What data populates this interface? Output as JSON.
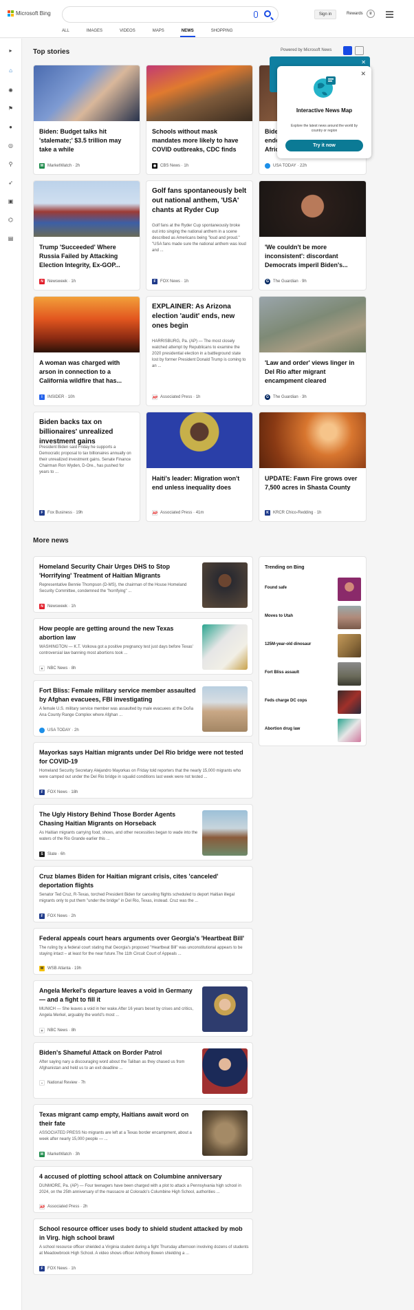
{
  "header": {
    "brand": "Microsoft Bing",
    "search_value": "",
    "signin": "Sign in",
    "rewards": "Rewards",
    "tabs": [
      "ALL",
      "IMAGES",
      "VIDEOS",
      "MAPS",
      "NEWS",
      "SHOPPING"
    ],
    "active_tab": "NEWS",
    "accent": "#174ae4"
  },
  "top": {
    "title": "Top stories",
    "powered": "Powered by Microsoft News"
  },
  "popup": {
    "title": "Interactive News Map",
    "desc": "Explore the latest news around the world by country or region",
    "button": "Try it now"
  },
  "cards": [
    {
      "title": "Biden: Budget talks hit 'stalemate;' $3.5 trillion may take a while",
      "source": "MarketWatch",
      "time": "2h",
      "snippet": ""
    },
    {
      "title": "Schools without mask mandates more likely to have COVID outbreaks, CDC finds",
      "source": "CBS News",
      "time": "1h",
      "snippet": ""
    },
    {
      "title": "Biden endo... Afric...",
      "source": "USA TODAY",
      "time": "22h",
      "snippet": ""
    },
    {
      "title": "Trump 'Succeeded' Where Russia Failed by Attacking Election Integrity, Ex-GOP...",
      "source": "Newsweek",
      "time": "1h",
      "snippet": ""
    },
    {
      "title": "Golf fans spontaneously belt out national anthem, 'USA' chants at Ryder Cup",
      "source": "FOX News",
      "time": "1h",
      "snippet": "Golf fans at the Ryder Cup spontaneously broke out into singing the national anthem in a scene described as Americans being \"loud and proud.\" \"USA fans made sure the national anthem was loud and ..."
    },
    {
      "title": "'We couldn't be more inconsistent': discordant Democrats imperil Biden's...",
      "source": "The Guardian",
      "time": "9h",
      "snippet": ""
    },
    {
      "title": "A woman was charged with arson in connection to a California wildfire that has...",
      "source": "INSIDER",
      "time": "10h",
      "snippet": ""
    },
    {
      "title": "EXPLAINER: As Arizona election 'audit' ends, new ones begin",
      "source": "Associated Press",
      "time": "1h",
      "snippet": "HARRISBURG, Pa. (AP) — The most closely watched attempt by Republicans to examine the 2020 presidential election in a battleground state lost by former President Donald Trump is coming to an ..."
    },
    {
      "title": "'Law and order' views linger in Del Rio after migrant encampment cleared",
      "source": "The Guardian",
      "time": "3h",
      "snippet": ""
    },
    {
      "title": "Biden backs tax on billionaires' unrealized investment gains",
      "source": "Fox Business",
      "time": "19h",
      "snippet": "President Biden said Friday he supports a Democratic proposal to tax billionaires annually on their unrealized investment gains. Senate Finance Chairman Ron Wyden, D-Ore., has pushed for years to ..."
    },
    {
      "title": "Haiti's leader: Migration won't end unless inequality does",
      "source": "Associated Press",
      "time": "41m",
      "snippet": ""
    },
    {
      "title": "UPDATE: Fawn Fire grows over 7,500 acres in Shasta County",
      "source": "KRCR Chico-Redding",
      "time": "1h",
      "snippet": ""
    }
  ],
  "more": {
    "title": "More news",
    "items": [
      {
        "title": "Homeland Security Chair Urges DHS to Stop 'Horrifying' Treatment of Haitian Migrants",
        "snippet": "Representative Bennie Thompson (D-MS), the chairman of the House Homeland Security Committee, condemned the \"horrifying\" ...",
        "source": "Newsweek",
        "time": "1h"
      },
      {
        "title": "How people are getting around the new Texas abortion law",
        "snippet": "WASHINGTON — K.T. Volkova got a positive pregnancy test just days before Texas' controversial law banning most abortions took ...",
        "source": "NBC News",
        "time": "8h"
      },
      {
        "title": "Fort Bliss: Female military service member assaulted by Afghan evacuees, FBI investigating",
        "snippet": "A female U.S. military service member was assaulted by male evacuees at the Doña Ana County Range Complex where Afghan ...",
        "source": "USA TODAY",
        "time": "2h"
      },
      {
        "title": "Mayorkas says Haitian migrants under Del Rio bridge were not tested for COVID-19",
        "snippet": "Homeland Security Secretary Alejandro Mayorkas on Friday told reporters that the nearly 15,000 migrants who were camped out under the Del Rio bridge in squalid conditions last week were not tested ...",
        "source": "FOX News",
        "time": "18h"
      },
      {
        "title": "The Ugly History Behind Those Border Agents Chasing Haitian Migrants on Horseback",
        "snippet": "As Haitian migrants carrying food, shoes, and other necessities began to wade into the waters of the Rio Grande earlier this ...",
        "source": "Slate",
        "time": "6h"
      },
      {
        "title": "Cruz blames Biden for Haitian migrant crisis, cites 'canceled' deportation flights",
        "snippet": "Senator Ted Cruz, R-Texas, torched President Biden for canceling flights scheduled to deport Haitian illegal migrants only to put them \"under the bridge\" in Del Rio, Texas, instead. Cruz was the ...",
        "source": "FOX News",
        "time": "2h"
      },
      {
        "title": "Federal appeals court hears arguments over Georgia's 'Heartbeat Bill'",
        "snippet": "The ruling by a federal court stating that Georgia's proposed \"Heartbeat Bill\" was unconstitutional appears to be staying intact – at least for the near future.The 11th Circuit Court of Appeals ...",
        "source": "WSB Atlanta",
        "time": "19h"
      },
      {
        "title": "Angela Merkel's departure leaves a void in Germany — and a fight to fill it",
        "snippet": "MUNICH — She leaves a void in her wake.After 16 years beset by crises and critics, Angela Merkel, arguably the world's most ...",
        "source": "NBC News",
        "time": "8h"
      },
      {
        "title": "Biden's Shameful Attack on Border Patrol",
        "snippet": "After saying nary a discouraging word about the Taliban as they chased us from Afghanistan and held us to an exit deadline ...",
        "source": "National Review",
        "time": "7h"
      },
      {
        "title": "Texas migrant camp empty, Haitians await word on their fate",
        "snippet": "ASSOCIATED PRESS No migrants are left at a Texas border encampment, about a week after nearly 15,000 people — ...",
        "source": "MarketWatch",
        "time": "3h"
      },
      {
        "title": "4 accused of plotting school attack on Columbine anniversary",
        "snippet": "DUNMORE, Pa. (AP) — Four teenagers have been charged with a plot to attack a Pennsylvania high school in 2024, on the 25th anniversary of the massacre at Colorado's Columbine High School, authorities ...",
        "source": "Associated Press",
        "time": "2h"
      },
      {
        "title": "School resource officer uses body to shield student attacked by mob in Virg. high school brawl",
        "snippet": "A school resource officer shielded a Virginia student during a fight Thursday afternoon involving dozens of students at Meadowbrook High School. A video shows officer Anthony Bowen shielding a ...",
        "source": "FOX News",
        "time": "1h"
      }
    ]
  },
  "trending": {
    "title": "Trending on Bing",
    "items": [
      "Found safe",
      "Moves to Utah",
      "125M-year-old dinosaur",
      "Fort Bliss assault",
      "Feds charge DC cops",
      "Abortion drug law"
    ]
  }
}
